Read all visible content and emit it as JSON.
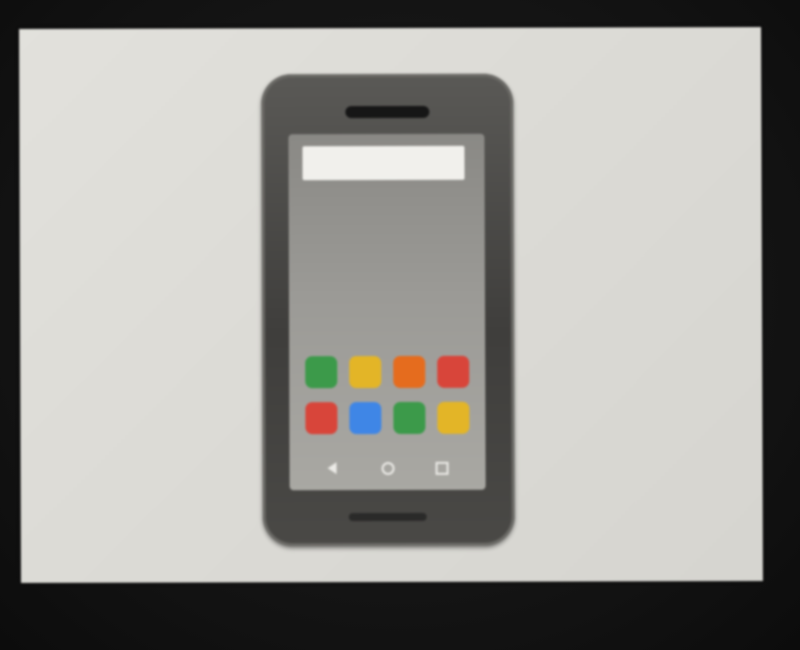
{
  "device": {
    "search_bar": {
      "value": "",
      "placeholder": ""
    },
    "apps": [
      {
        "icon": "green-app-icon",
        "color": "#3c9a4a"
      },
      {
        "icon": "yellow-app-icon",
        "color": "#e3b527"
      },
      {
        "icon": "orange-app-icon",
        "color": "#e56c1e"
      },
      {
        "icon": "red-app-icon",
        "color": "#d8453a"
      },
      {
        "icon": "red-app-icon",
        "color": "#d8453a"
      },
      {
        "icon": "blue-app-icon",
        "color": "#3f86e6"
      },
      {
        "icon": "green-app-icon",
        "color": "#3c9a4a"
      },
      {
        "icon": "yellow-app-icon",
        "color": "#e3b527"
      }
    ],
    "nav": [
      "back-icon",
      "home-icon",
      "recents-icon"
    ],
    "colors": {
      "screen_background": "#9b9a96",
      "phone_body": "#4a4946",
      "display_background": "#dcdbd6"
    }
  }
}
